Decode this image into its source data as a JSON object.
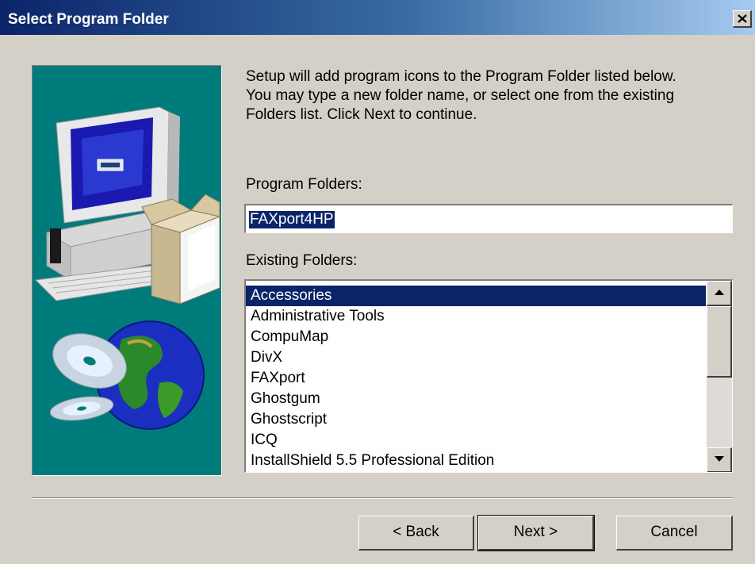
{
  "window": {
    "title": "Select Program Folder",
    "close_icon": "close-icon"
  },
  "description": "Setup will add program icons to the Program Folder listed below.\nYou may type a new folder name, or select one from the existing\nFolders list.  Click Next to continue.",
  "program_folders": {
    "label": "Program Folders:",
    "value": "FAXport4HP"
  },
  "existing_folders": {
    "label": "Existing Folders:",
    "items": [
      {
        "label": "Accessories",
        "selected": true
      },
      {
        "label": "Administrative Tools"
      },
      {
        "label": "CompuMap"
      },
      {
        "label": "DivX"
      },
      {
        "label": "FAXport"
      },
      {
        "label": "Ghostgum"
      },
      {
        "label": "Ghostscript"
      },
      {
        "label": "ICQ"
      },
      {
        "label": "InstallShield 5.5 Professional Edition"
      }
    ]
  },
  "buttons": {
    "back": "< Back",
    "next": "Next >",
    "cancel": "Cancel"
  },
  "colors": {
    "title_gradient_start": "#0a246a",
    "title_gradient_end": "#a6caf0",
    "selection": "#0a246a",
    "art_background": "#007b7b",
    "dialog_face": "#d4d0c8"
  }
}
